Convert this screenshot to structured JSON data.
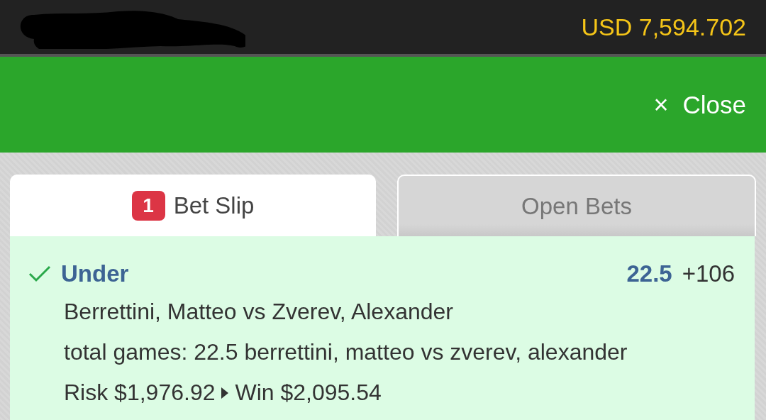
{
  "header": {
    "balance": "USD 7,594.702",
    "redacted": true
  },
  "toolbar": {
    "close_label": "Close",
    "close_icon": "×"
  },
  "tabs": [
    {
      "label": "Bet Slip",
      "badge": "1",
      "selected": true
    },
    {
      "label": "Open Bets",
      "selected": false
    }
  ],
  "bet": {
    "checked": true,
    "selection": "Under",
    "line": "22.5",
    "odds": "+106",
    "match": "Berrettini, Matteo vs Zverev, Alexander",
    "description": "total games: 22.5 berrettini, matteo vs zverev, alexander",
    "risk": "Risk $1,976.92",
    "win": "Win $2,095.54"
  }
}
